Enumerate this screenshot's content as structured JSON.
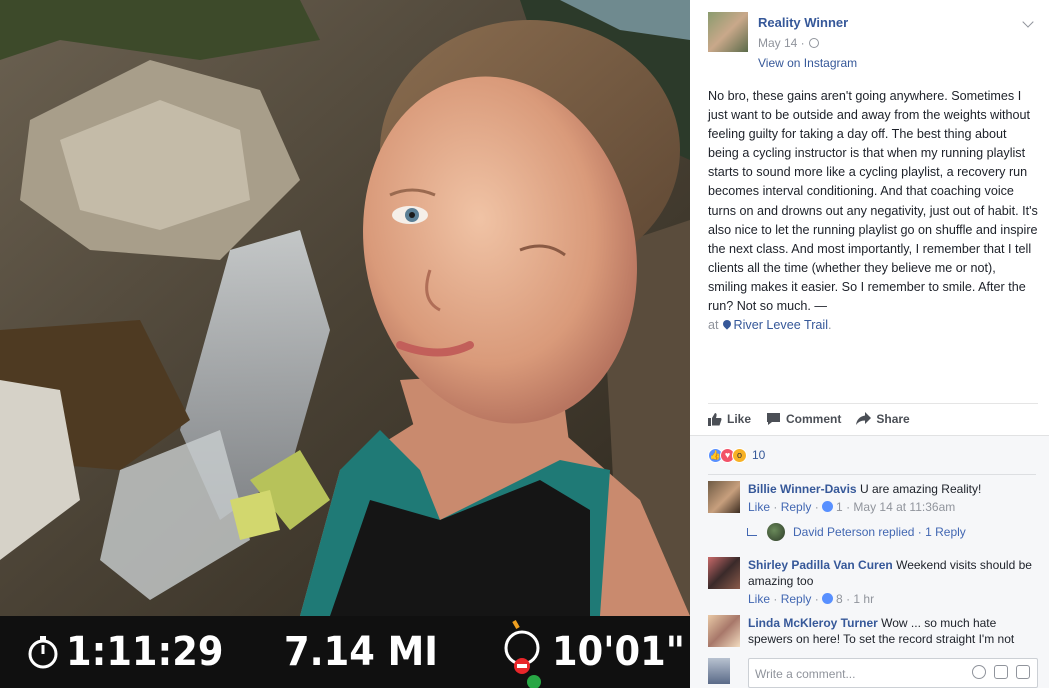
{
  "photo": {
    "stats": {
      "time": "1:11:29",
      "distance": "7.14 MI",
      "pace": "10'01\""
    },
    "icons": {
      "time": "stopwatch-icon",
      "pace": "pace-gauge-icon"
    }
  },
  "post": {
    "author": "Reality Winner",
    "date": "May 14 ·",
    "source_link": "View on Instagram",
    "text": "No bro, these gains aren't going anywhere. Sometimes I just want to be outside and away from the weights without feeling guilty for taking a day off. The best thing about being a cycling instructor is that when my running playlist starts to sound more like a cycling playlist, a recovery run becomes interval conditioning. And that coaching voice turns on and drowns out any negativity, just out of habit. It's also nice to let the running playlist go on shuffle and inspire the next class. And most importantly, I remember that I tell clients all the time (whether they believe me or not), smiling makes it easier. So I remember to smile. After the run? Not so much. —",
    "location_prefix": "at",
    "location": "River Levee Trail",
    "location_suffix": "."
  },
  "actions": {
    "like": "Like",
    "comment": "Comment",
    "share": "Share"
  },
  "reactions": {
    "count": "10",
    "types": [
      "like",
      "love",
      "wow"
    ]
  },
  "comments": [
    {
      "name": "Billie Winner-Davis",
      "text": "U are amazing Reality!",
      "like": "Like",
      "reply": "Reply",
      "likes": "1",
      "time": "May 14 at 11:36am"
    },
    {
      "name": "Shirley Padilla Van Curen",
      "text": "Weekend visits should be amazing too",
      "like": "Like",
      "reply": "Reply",
      "likes": "8",
      "time": "1 hr"
    },
    {
      "name": "Linda McKleroy Turner",
      "text": "Wow ... so much hate spewers on here! To set the record straight I'm not"
    }
  ],
  "reply_summary": {
    "name": "David Peterson",
    "text": "replied",
    "count": "1 Reply"
  },
  "composer": {
    "placeholder": "Write a comment..."
  },
  "colors": {
    "link": "#365899",
    "meta": "#90949c",
    "stats_bg": "#101010",
    "accent_pace": "#e8262a"
  }
}
